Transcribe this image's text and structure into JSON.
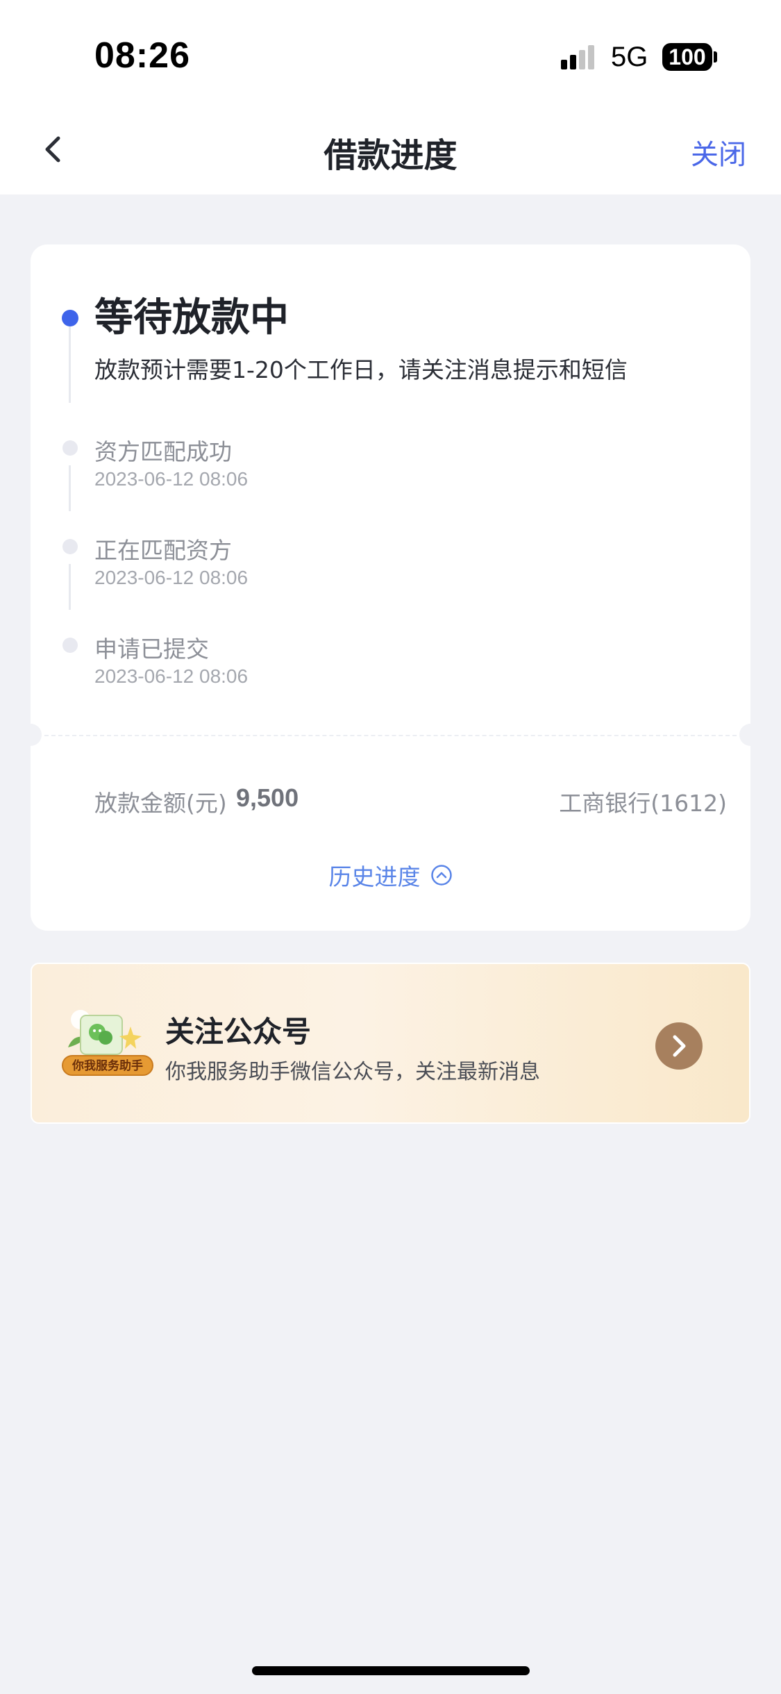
{
  "status_bar": {
    "time": "08:26",
    "network": "5G",
    "battery": "100"
  },
  "nav": {
    "back_icon": "chevron-left-icon",
    "title": "借款进度",
    "close_label": "关闭"
  },
  "progress": {
    "current": {
      "title": "等待放款中",
      "description": "放款预计需要1-20个工作日，请关注消息提示和短信"
    },
    "steps": [
      {
        "title": "资方匹配成功",
        "time": "2023-06-12 08:06"
      },
      {
        "title": "正在匹配资方",
        "time": "2023-06-12 08:06"
      },
      {
        "title": "申请已提交",
        "time": "2023-06-12 08:06"
      }
    ],
    "amount_label": "放款金额(元)",
    "amount_value": "9,500",
    "bank": "工商银行(1612)",
    "history_label": "历史进度"
  },
  "follow": {
    "logo_text": "你我服务助手",
    "title": "关注公众号",
    "subtitle": "你我服务助手微信公众号，关注最新消息"
  },
  "colors": {
    "accent": "#3e64ea",
    "link": "#4a67e8",
    "background": "#f1f2f6",
    "banner_arrow": "#a7805e"
  }
}
